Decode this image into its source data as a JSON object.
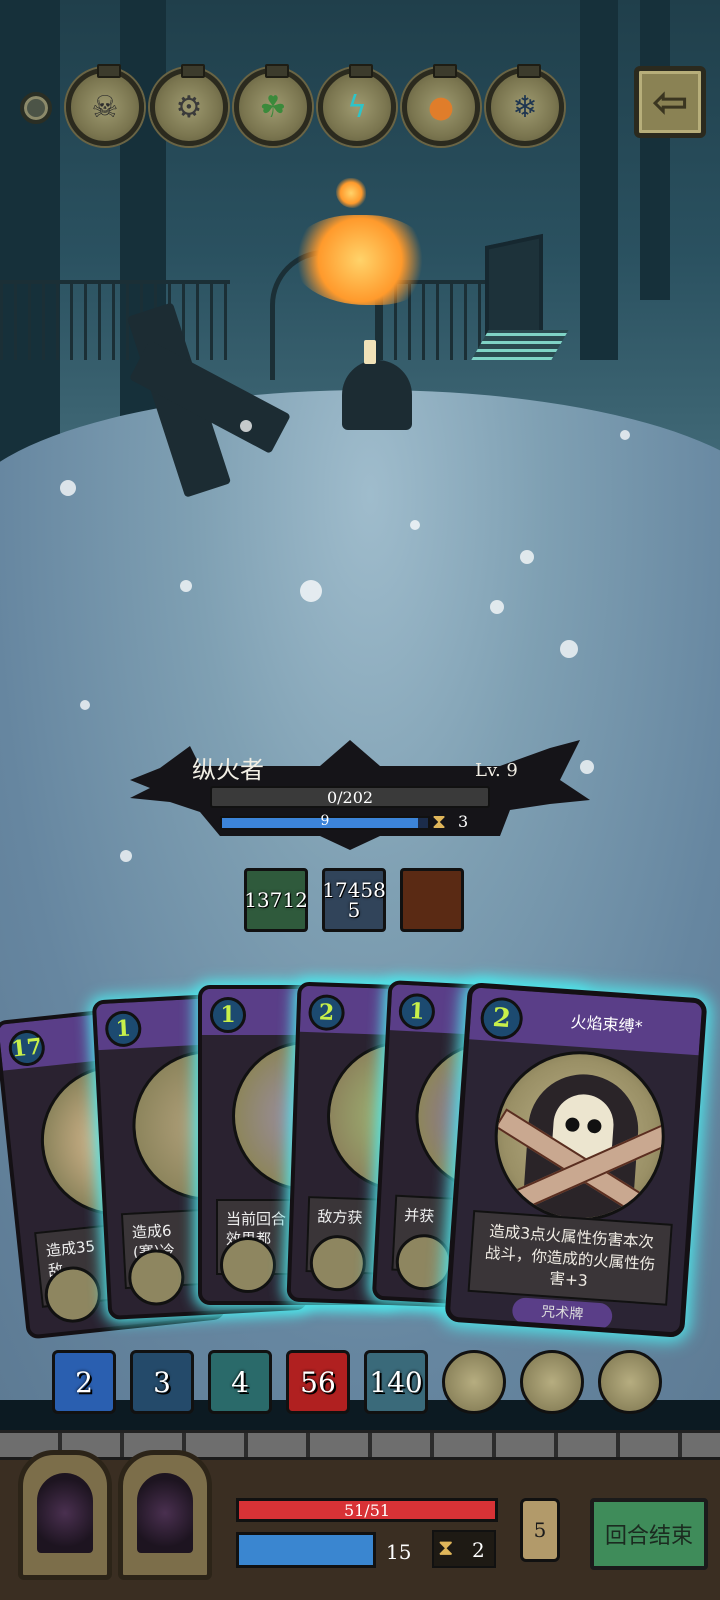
{
  "relics": [
    {
      "icon": "skull-bag-relic-icon",
      "glyph": "☠",
      "color": "#2d2d2d"
    },
    {
      "icon": "gear-skull-relic-icon",
      "glyph": "⚙",
      "color": "#3a3a3a"
    },
    {
      "icon": "green-potion-relic-icon",
      "glyph": "☘",
      "color": "#3b8a3b"
    },
    {
      "icon": "lightning-relic-icon",
      "glyph": "ϟ",
      "color": "#2ec4c8"
    },
    {
      "icon": "orange-orb-relic-icon",
      "glyph": "●",
      "color": "#e07d2a"
    },
    {
      "icon": "ice-relic-icon",
      "glyph": "❄",
      "color": "#1e3550"
    }
  ],
  "enemy": {
    "name": "纵火者",
    "level": "Lv. 9",
    "hp": "0/202",
    "shield": "9",
    "shield_fraction": 0.95,
    "timer": "3"
  },
  "buffs": [
    {
      "icon": "poison-orb-icon",
      "text": "13712",
      "color": "#2f5a3c"
    },
    {
      "icon": "frost-shard-icon",
      "text": "17458\n5",
      "color": "#31445a"
    },
    {
      "icon": "burning-fence-icon",
      "text": "",
      "color": "#5a2a14"
    }
  ],
  "cards": [
    {
      "cost": "17",
      "desc": "造成35\n敌",
      "art": "#e8c49a"
    },
    {
      "cost": "1",
      "desc": "造成6\n(寒)冷\n方",
      "art": "#b7a57f"
    },
    {
      "cost": "1",
      "desc": "当前回合\n效果都",
      "art": "#9c8fb0"
    },
    {
      "cost": "2",
      "desc": "敌方获",
      "art": "#a3c07a"
    },
    {
      "cost": "1",
      "desc": "并获",
      "art": "#8c6dbf"
    }
  ],
  "main_card": {
    "cost": "2",
    "title": "火焰束缚*",
    "desc": "造成3点火属性伤害本次战斗，你造成的火属性伤害+3",
    "type": "咒术牌"
  },
  "piles": [
    {
      "icon": "draw-pile-icon",
      "value": "2",
      "color": "#2a5fb0"
    },
    {
      "icon": "ice-pile-icon",
      "value": "3",
      "color": "#244a6a"
    },
    {
      "icon": "shield-pile-icon",
      "value": "4",
      "color": "#2a6a6a"
    },
    {
      "icon": "fire-pile-icon",
      "value": "56",
      "color": "#b02020"
    },
    {
      "icon": "frost-pile-icon",
      "value": "140",
      "color": "#3a6a7a"
    }
  ],
  "round_icons": [
    "frost-rune-icon",
    "ice-orb-icon",
    "warrior-portrait-icon"
  ],
  "player": {
    "hp": "51/51",
    "hp_fraction": 1.0,
    "energy": "15",
    "energy_fraction": 1.0,
    "hourglass": "2",
    "deck": "5",
    "end_turn": "回合结束"
  }
}
